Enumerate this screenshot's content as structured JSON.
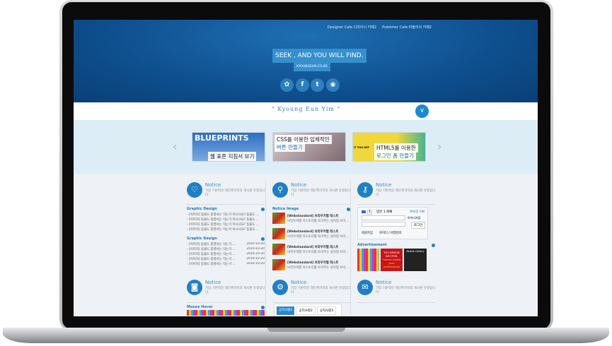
{
  "header": {
    "links": [
      "Designer Cafe 디자이너 카페2",
      "Publisher Cafe 퍼블리셔 카페2"
    ],
    "slogan": "SEEK , AND YOU WILL FIND.",
    "site": "KYOUNGEUN.CO.KR",
    "social": [
      "pinwheel-icon",
      "facebook-icon",
      "twitter-icon",
      "rss-icon"
    ]
  },
  "strip": {
    "name": "\" Kyoung Eun Yim \""
  },
  "banners": [
    {
      "big": "BLUEPRINTS",
      "line1": "웹 표준 지침서 보기"
    },
    {
      "line1": "CSS를 이용한 입체적인",
      "line2": "버튼 만들기"
    },
    {
      "tag": "IT YOU GET",
      "line1": "HTML5를 이용한",
      "line2": "로그인 폼 만들기"
    }
  ],
  "notice": {
    "title": "Notice",
    "desc": "가장 기본적인 레인폭이지의 게시판 유형입니다."
  },
  "col1": {
    "sec1": "Graphic Design",
    "items1": [
      "- [이미지] 동물도 종영서는 직는가 아시나요? 동물도 ...",
      "- [이미지] 동물도 종영서는 직는가 아시나요? 동물도 ...",
      "- [이미지] 동물도 종영서는 직는가 아시나요? 동물도 ...",
      "- [이미지] 동물도 종영서는 직는가 아시나요? 동물도 ..."
    ],
    "sec2": "Graphic Design",
    "items2": [
      {
        "t": "- [이미지] 동물도 종영서는 직는가 ...",
        "d": "2016-10-20"
      },
      {
        "t": "- [이미지] 동물도 종영서는 직는가 ...",
        "d": "2016-10-20"
      },
      {
        "t": "- [이미지] 동물도 종영서는 직는가 ...",
        "d": "2016-10-20"
      },
      {
        "t": "- [이미지] 동물도 종영서는 직는가 ...",
        "d": "2016-10-20"
      },
      {
        "t": "- [이미지] 동물도 종영서는 직는가 ...",
        "d": "2016-10-20"
      }
    ],
    "sec3": "Mouse Hover"
  },
  "col2": {
    "sec": "Notice Image",
    "items": [
      {
        "t": "[Webstandard] 브라우저별 테스트",
        "s": "브라우저별 히스토리를 토라주는 설치형 브라..."
      },
      {
        "t": "[Webstandard] 브라우저별 테스트",
        "s": "브라우저별 히스토리를 토라주는 설치형 브라..."
      },
      {
        "t": "[Webstandard] 브라우저별 테스트",
        "s": "브라우저별 히스토리를 토라주는 설치형 브라..."
      },
      {
        "t": "[Webstandard] 브라우저별 테스트",
        "s": "브라우저별 히스토리를 토라주는 설치형 브라..."
      }
    ],
    "tabs": [
      "공지사항1",
      "공지사항2",
      "공지사항3"
    ]
  },
  "col3": {
    "login": {
      "page": "1",
      "visit": "방문 1 회째",
      "join_link": "IP보안 ON",
      "save": "아이디저장",
      "btn": "로그인",
      "signup": "회원가입",
      "find": "아이디 / 비밀번호"
    },
    "sec": "Advertisement",
    "ad2": [
      "YOU DESIGN",
      "WE HTML",
      "Human coded",
      "pure professionals"
    ],
    "ad3": "Mobile Gallery"
  }
}
